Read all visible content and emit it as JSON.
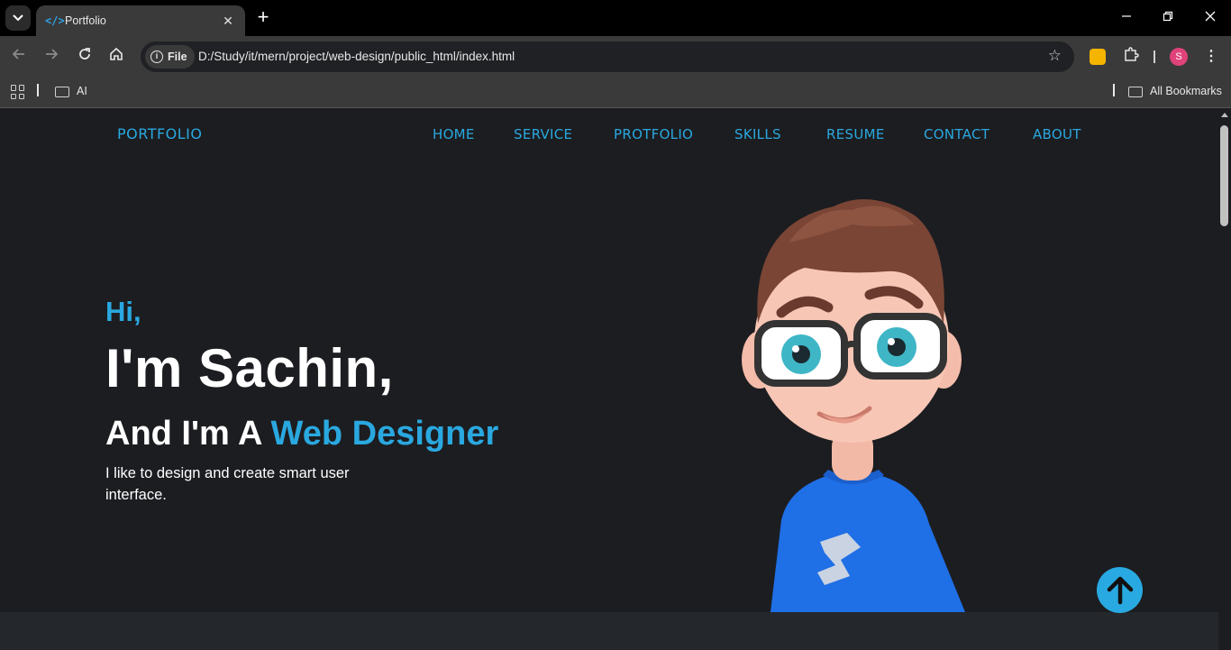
{
  "browser": {
    "tab_title": "Portfolio",
    "tab_favicon": "</>",
    "url_scheme_label": "File",
    "url": "D:/Study/it/mern/project/web-design/public_html/index.html",
    "profile_initial": "S",
    "bookmarks": [
      {
        "label": "AI"
      }
    ],
    "all_bookmarks_label": "All Bookmarks"
  },
  "site": {
    "brand": "PORTFOLIO",
    "nav": [
      "HOME",
      "SERVICE",
      "PROTFOLIO",
      "SKILLS",
      "RESUME",
      "CONTACT",
      "ABOUT"
    ],
    "hero": {
      "greeting": "Hi,",
      "name_line": "I'm Sachin,",
      "role_prefix": "And I'm A ",
      "role_highlight": "Web Designer",
      "description": "I like to design and create smart user interface."
    },
    "accent_color": "#2aa8e0"
  }
}
